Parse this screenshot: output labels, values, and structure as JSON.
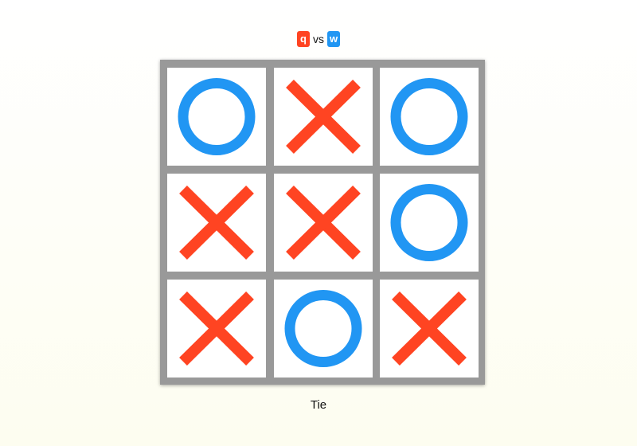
{
  "header": {
    "player_x": "q",
    "vs_label": "vs",
    "player_o": "w"
  },
  "colors": {
    "x_mark": "#ff4422",
    "o_mark": "#2196f3",
    "board_frame": "#999999",
    "cell_bg": "#ffffff"
  },
  "board": {
    "cells": [
      "O",
      "X",
      "O",
      "X",
      "X",
      "O",
      "X",
      "O",
      "X"
    ]
  },
  "status": {
    "text": "Tie"
  }
}
